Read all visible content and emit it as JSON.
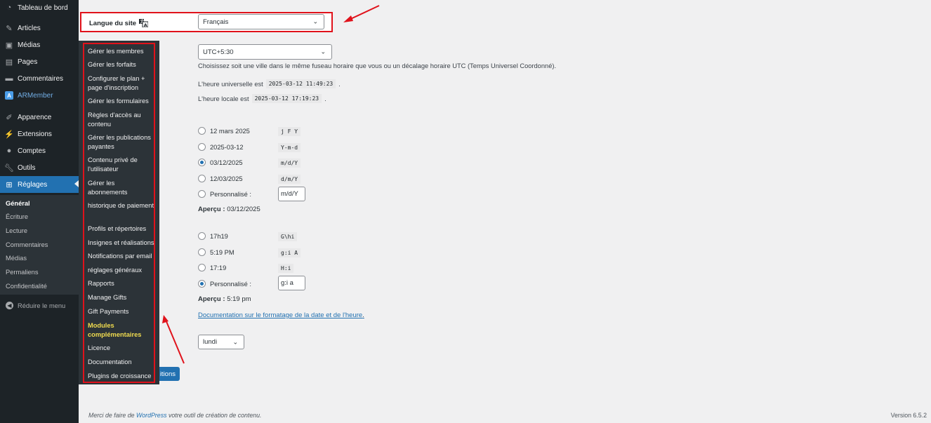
{
  "sidebar": {
    "items": [
      {
        "label": "Tableau de bord",
        "icon": "dashboard-icon"
      },
      {
        "label": "Articles",
        "icon": "pin-icon"
      },
      {
        "label": "Médias",
        "icon": "media-icon"
      },
      {
        "label": "Pages",
        "icon": "page-icon"
      },
      {
        "label": "Commentaires",
        "icon": "comment-icon"
      },
      {
        "label": "ARMember",
        "icon": "armember-logo-icon"
      },
      {
        "label": "Apparence",
        "icon": "brush-icon"
      },
      {
        "label": "Extensions",
        "icon": "plugin-icon"
      },
      {
        "label": "Comptes",
        "icon": "user-icon"
      },
      {
        "label": "Outils",
        "icon": "wrench-icon"
      },
      {
        "label": "Réglages",
        "icon": "settings-icon"
      }
    ],
    "submenu": [
      "Général",
      "Écriture",
      "Lecture",
      "Commentaires",
      "Médias",
      "Permaliens",
      "Confidentialité"
    ],
    "collapse_label": "Réduire le menu"
  },
  "flyout": {
    "items": [
      "Gérer les membres",
      "Gérer les forfaits",
      "Configurer le plan + page d'inscription",
      "Gérer les formulaires",
      "Règles d'accès au contenu",
      "Gérer les publications payantes",
      "Contenu privé de l'utilisateur",
      "Gérer les abonnements",
      "historique de paiement",
      "Profils et répertoires",
      "Insignes et réalisations",
      "Notifications par email",
      "réglages généraux",
      "Rapports",
      "Manage Gifts",
      "Gift Payments",
      "Modules complémentaires",
      "Licence",
      "Documentation",
      "Plugins de croissance"
    ]
  },
  "language": {
    "label": "Langue du site",
    "value": "Français"
  },
  "timezone": {
    "value": "UTC+5:30",
    "help": "Choisissez soit une ville dans le même fuseau horaire que vous ou un décalage horaire UTC (Temps Universel Coordonné).",
    "utc_label": "L'heure universelle est",
    "utc_value": "2025-03-12 11:49:23",
    "local_label": "L'heure locale est",
    "local_value": "2025-03-12 17:19:23",
    "period": "."
  },
  "date_format": {
    "options": [
      {
        "label": "12 mars 2025",
        "code": "j F Y",
        "checked": false
      },
      {
        "label": "2025-03-12",
        "code": "Y-m-d",
        "checked": false
      },
      {
        "label": "03/12/2025",
        "code": "m/d/Y",
        "checked": true
      },
      {
        "label": "12/03/2025",
        "code": "d/m/Y",
        "checked": false
      }
    ],
    "custom_label": "Personnalisé :",
    "custom_value": "m/d/Y",
    "preview_label": "Aperçu :",
    "preview_value": "03/12/2025"
  },
  "time_format": {
    "options": [
      {
        "label": "17h19",
        "code": "G\\hi",
        "checked": false
      },
      {
        "label": "5:19 PM",
        "code": "g:i A",
        "checked": false
      },
      {
        "label": "17:19",
        "code": "H:i",
        "checked": false
      }
    ],
    "custom_label": "Personnalisé :",
    "custom_value": "g:i a",
    "preview_label": "Aperçu :",
    "preview_value": "5:19 pm"
  },
  "doc_link": "Documentation sur le formatage de la date et de l'heure",
  "doc_link_period": ".",
  "week_start": {
    "value": "lundi"
  },
  "save_button_visible": "itions",
  "footer": {
    "prefix": "Merci de faire de",
    "link": "WordPress",
    "suffix": "votre outil de création de contenu.",
    "version": "Version 6.5.2"
  },
  "colors": {
    "accent": "#2271b1",
    "highlight": "#e0121b",
    "sidebar": "#1d2327",
    "flyout": "#2c3338"
  }
}
